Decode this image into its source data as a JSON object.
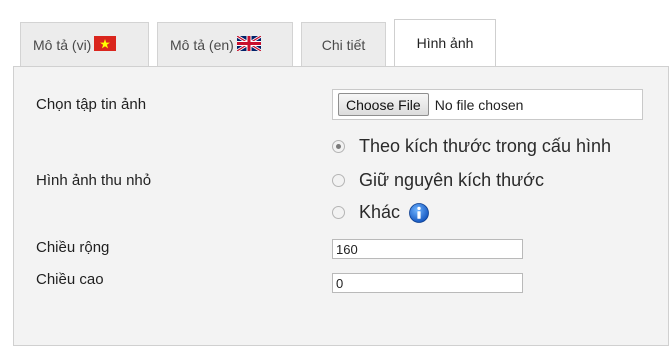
{
  "tabs": [
    {
      "label": "Mô tả (vi)",
      "flag": "vietnam-flag-icon",
      "active": false
    },
    {
      "label": "Mô tả (en)",
      "flag": "uk-flag-icon",
      "active": false
    },
    {
      "label": "Chi tiết",
      "active": false
    },
    {
      "label": "Hình ảnh",
      "active": true
    }
  ],
  "form": {
    "file_label": "Chọn tập tin ảnh",
    "file_button": "Choose File",
    "file_status": "No file chosen",
    "thumb_label": "Hình ảnh thu nhỏ",
    "radio_options": [
      {
        "label": "Theo kích thước trong cấu hình",
        "checked": true
      },
      {
        "label": "Giữ nguyên kích thước",
        "checked": false
      },
      {
        "label": "Khác",
        "checked": false
      }
    ],
    "info_icon": "info-icon",
    "width_label": "Chiều rộng",
    "width_value": "160",
    "height_label": "Chiều cao",
    "height_value": "0"
  },
  "colors": {
    "vn_red": "#da251d",
    "vn_star": "#ffff00",
    "uk_blue": "#012169",
    "uk_red": "#c8102e",
    "info_blue": "#1e6fd6"
  }
}
